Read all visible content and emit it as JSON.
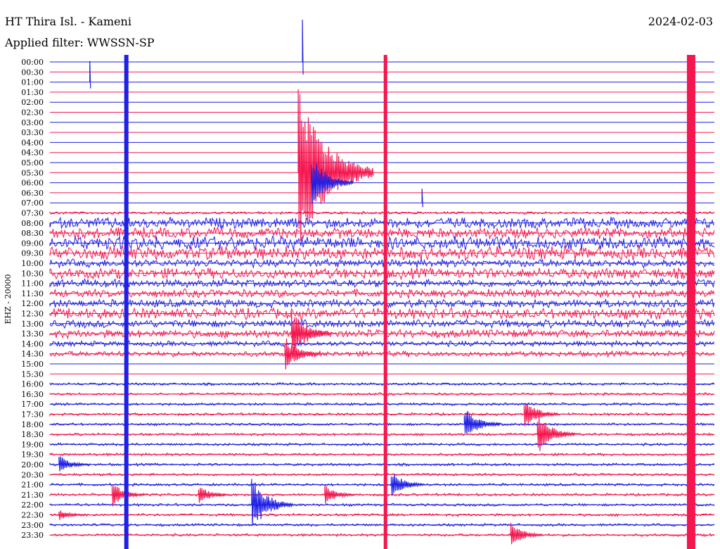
{
  "header": {
    "station": "HT Thira Isl. - Kameni",
    "filter": "Applied filter: WWSSN-SP",
    "date": "2024-02-03"
  },
  "colors": {
    "blue": "#1f1fe6",
    "red": "#f5164f"
  },
  "chart_data": {
    "type": "line",
    "ylabel": "EHZ - 20000",
    "tick_labels": [
      "00:00",
      "00:30",
      "01:00",
      "01:30",
      "02:00",
      "02:30",
      "03:00",
      "03:30",
      "04:00",
      "04:30",
      "05:00",
      "05:30",
      "06:00",
      "06:30",
      "07:00",
      "07:30",
      "08:00",
      "08:30",
      "09:00",
      "09:30",
      "10:00",
      "10:30",
      "11:00",
      "11:30",
      "12:00",
      "12:30",
      "13:00",
      "13:30",
      "14:00",
      "14:30",
      "15:00",
      "15:30",
      "16:00",
      "16:30",
      "17:00",
      "17:30",
      "18:00",
      "18:30",
      "19:00",
      "19:30",
      "20:00",
      "20:30",
      "21:00",
      "21:30",
      "22:00",
      "22:30",
      "23:00",
      "23:30"
    ],
    "trace_colors": [
      "blue",
      "red"
    ],
    "noise_level": [
      0,
      0,
      0,
      0,
      0,
      0,
      0,
      0,
      0,
      0,
      0,
      0,
      0,
      0,
      0,
      1,
      4,
      4,
      5,
      5,
      3,
      4,
      3,
      3,
      3,
      4,
      3,
      3,
      2,
      2,
      0,
      0,
      1,
      1,
      1,
      1,
      1,
      1,
      1,
      1,
      1,
      1,
      1,
      1,
      1,
      1,
      1,
      1
    ],
    "events": [
      {
        "row": 2,
        "x": 0.06,
        "amp": 30,
        "kind": "spike"
      },
      {
        "row": 14,
        "x": 0.56,
        "amp": 20,
        "kind": "spike"
      },
      {
        "row": 0,
        "x": 0.38,
        "amp": 60,
        "kind": "spike"
      },
      {
        "row": 11,
        "x": 0.38,
        "amp": 120,
        "kind": "burst"
      },
      {
        "row": 12,
        "x": 0.4,
        "amp": 40,
        "kind": "burst"
      },
      {
        "row": 27,
        "x": 0.37,
        "amp": 35,
        "kind": "burst"
      },
      {
        "row": 29,
        "x": 0.36,
        "amp": 25,
        "kind": "burst"
      },
      {
        "row": 36,
        "x": 0.63,
        "amp": 25,
        "kind": "burst"
      },
      {
        "row": 35,
        "x": 0.72,
        "amp": 22,
        "kind": "burst"
      },
      {
        "row": 37,
        "x": 0.74,
        "amp": 30,
        "kind": "burst"
      },
      {
        "row": 40,
        "x": 0.02,
        "amp": 14,
        "kind": "burst"
      },
      {
        "row": 42,
        "x": 0.52,
        "amp": 20,
        "kind": "burst"
      },
      {
        "row": 43,
        "x": 0.1,
        "amp": 18,
        "kind": "burst"
      },
      {
        "row": 43,
        "x": 0.23,
        "amp": 14,
        "kind": "burst"
      },
      {
        "row": 43,
        "x": 0.42,
        "amp": 14,
        "kind": "burst"
      },
      {
        "row": 44,
        "x": 0.31,
        "amp": 40,
        "kind": "burst"
      },
      {
        "row": 45,
        "x": 0.02,
        "amp": 8,
        "kind": "burst"
      },
      {
        "row": 47,
        "x": 0.7,
        "amp": 18,
        "kind": "burst"
      }
    ],
    "continuous": [
      {
        "x": 0.115,
        "color": "blue",
        "from_row": 0,
        "to_row": 47,
        "width": 6
      },
      {
        "x": 0.505,
        "color": "red",
        "from_row": 0,
        "to_row": 47,
        "width": 5
      },
      {
        "x": 0.965,
        "color": "red",
        "from_row": 0,
        "to_row": 47,
        "width": 12
      }
    ]
  }
}
